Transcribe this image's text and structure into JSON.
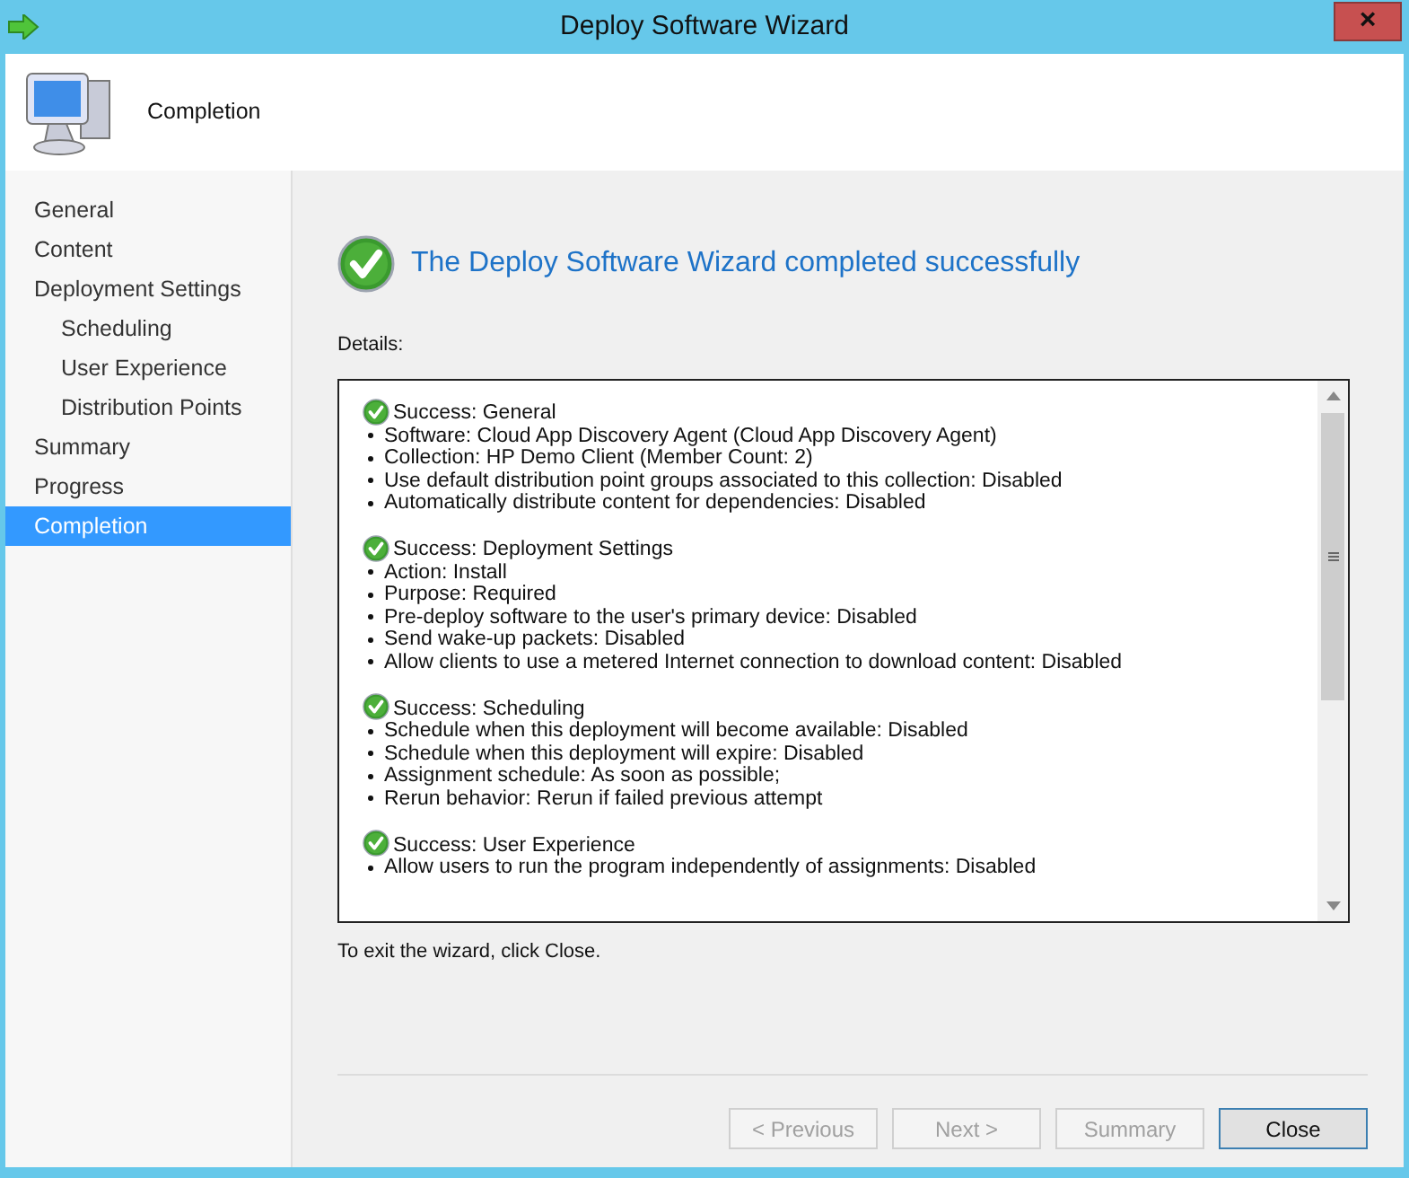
{
  "window": {
    "title": "Deploy Software Wizard",
    "close": "×"
  },
  "header": {
    "title": "Completion"
  },
  "sidebar": {
    "items": [
      {
        "label": "General",
        "selected": false
      },
      {
        "label": "Content",
        "selected": false
      },
      {
        "label": "Deployment Settings",
        "selected": false,
        "children": [
          {
            "label": "Scheduling",
            "selected": false
          },
          {
            "label": "User Experience",
            "selected": false
          },
          {
            "label": "Distribution Points",
            "selected": false
          }
        ]
      },
      {
        "label": "Summary",
        "selected": false
      },
      {
        "label": "Progress",
        "selected": false
      },
      {
        "label": "Completion",
        "selected": true
      }
    ]
  },
  "result": {
    "message": "The Deploy Software Wizard completed successfully"
  },
  "details": {
    "label": "Details:",
    "sections": [
      {
        "title": "Success: General",
        "items": [
          "Software: Cloud App Discovery Agent (Cloud App Discovery Agent)",
          "Collection: HP Demo Client (Member Count: 2)",
          "Use default distribution point groups associated to this collection: Disabled",
          "Automatically distribute content for dependencies: Disabled"
        ]
      },
      {
        "title": "Success: Deployment Settings",
        "items": [
          "Action: Install",
          "Purpose: Required",
          "Pre-deploy software to the user's primary device: Disabled",
          "Send wake-up packets: Disabled",
          "Allow clients to use a metered Internet connection to download content: Disabled"
        ]
      },
      {
        "title": "Success: Scheduling",
        "items": [
          "Schedule when this deployment will become available: Disabled",
          "Schedule when this deployment will expire: Disabled",
          "Assignment schedule: As soon as possible;",
          "Rerun behavior: Rerun if failed previous attempt"
        ]
      },
      {
        "title": "Success: User Experience",
        "items": [
          "Allow users to run the program independently of assignments: Disabled"
        ]
      }
    ]
  },
  "exit_hint": "To exit the wizard, click Close.",
  "buttons": [
    {
      "label": "< Previous",
      "disabled": true
    },
    {
      "label": "Next >",
      "disabled": true
    },
    {
      "label": "Summary",
      "disabled": true
    },
    {
      "label": "Close",
      "disabled": false
    }
  ]
}
